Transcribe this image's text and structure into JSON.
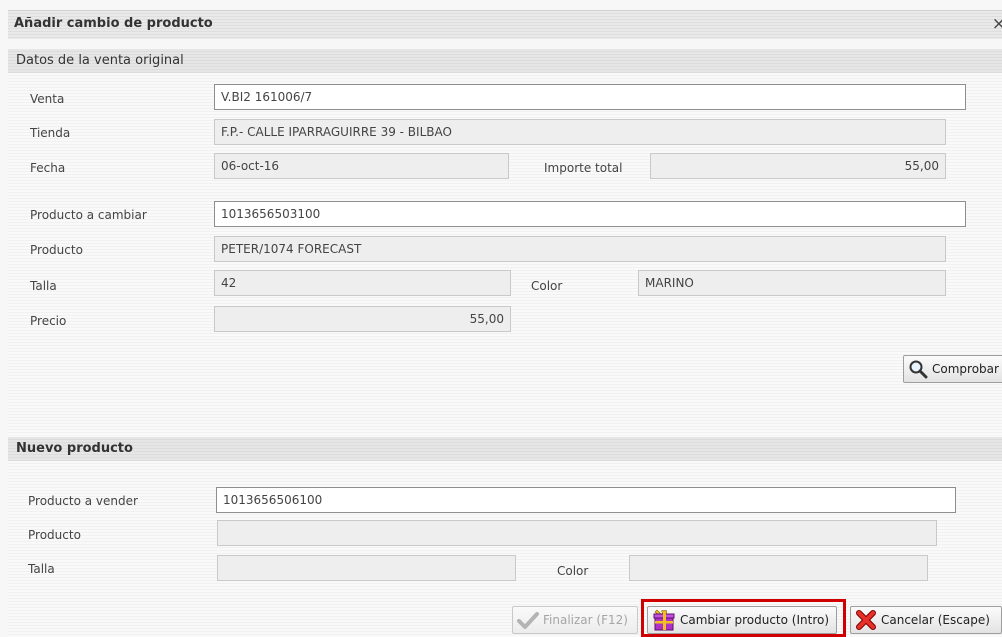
{
  "dialog": {
    "title": "Añadir cambio de producto",
    "close_symbol": "×"
  },
  "original_sale": {
    "section_title": "Datos de la venta original",
    "venta": {
      "label": "Venta",
      "value": "V.BI2 161006/7"
    },
    "tienda": {
      "label": "Tienda",
      "value": "F.P.- CALLE IPARRAGUIRRE 39 - BILBAO"
    },
    "fecha": {
      "label": "Fecha",
      "value": "06-oct-16"
    },
    "importe_total": {
      "label": "Importe total",
      "value": "55,00"
    },
    "producto_a_cambiar": {
      "label": "Producto a cambiar",
      "value": "1013656503100"
    },
    "producto": {
      "label": "Producto",
      "value": "PETER/1074 FORECAST"
    },
    "talla": {
      "label": "Talla",
      "value": "42"
    },
    "color": {
      "label": "Color",
      "value": "MARINO"
    },
    "precio": {
      "label": "Precio",
      "value": "55,00"
    },
    "comprobar_button": "Comprobar"
  },
  "new_product": {
    "section_title": "Nuevo producto",
    "producto_a_vender": {
      "label": "Producto a vender",
      "value": "1013656506100"
    },
    "producto": {
      "label": "Producto",
      "value": ""
    },
    "talla": {
      "label": "Talla",
      "value": ""
    },
    "color": {
      "label": "Color",
      "value": ""
    }
  },
  "footer": {
    "finalizar_label": "Finalizar (F12)",
    "cambiar_label": "Cambiar producto (Intro)",
    "cancelar_label": "Cancelar (Escape)",
    "highlight_color": "#d00000"
  }
}
